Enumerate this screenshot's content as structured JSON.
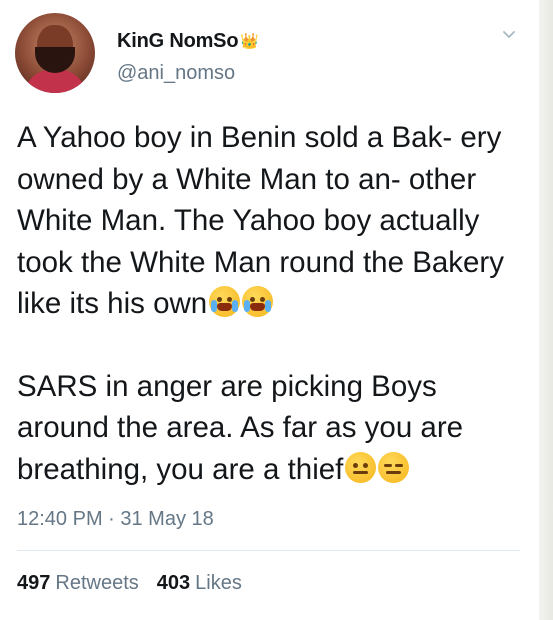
{
  "user": {
    "display_name": "KinG NomSo",
    "crown_emoji": "👑",
    "handle": "@ani_nomso"
  },
  "tweet": {
    "paragraph1": "A Yahoo boy in Benin sold a Bak- ery owned by a White Man to an- other White Man. The Yahoo boy actually took the White Man round the Bakery like its his own",
    "paragraph1_emojis": [
      "crying-face-icon",
      "crying-face-icon"
    ],
    "paragraph2": "SARS in anger are picking Boys around the area. As far as you are breathing, you are a thief",
    "paragraph2_emojis": [
      "neutral-face-icon",
      "expressionless-face-icon"
    ],
    "timestamp": "12:40 PM · 31 May 18"
  },
  "stats": {
    "retweets_count": "497",
    "retweets_label": "Retweets",
    "likes_count": "403",
    "likes_label": "Likes"
  },
  "colors": {
    "text_primary": "#14171a",
    "text_secondary": "#657786",
    "divider": "#e1e8ed"
  }
}
